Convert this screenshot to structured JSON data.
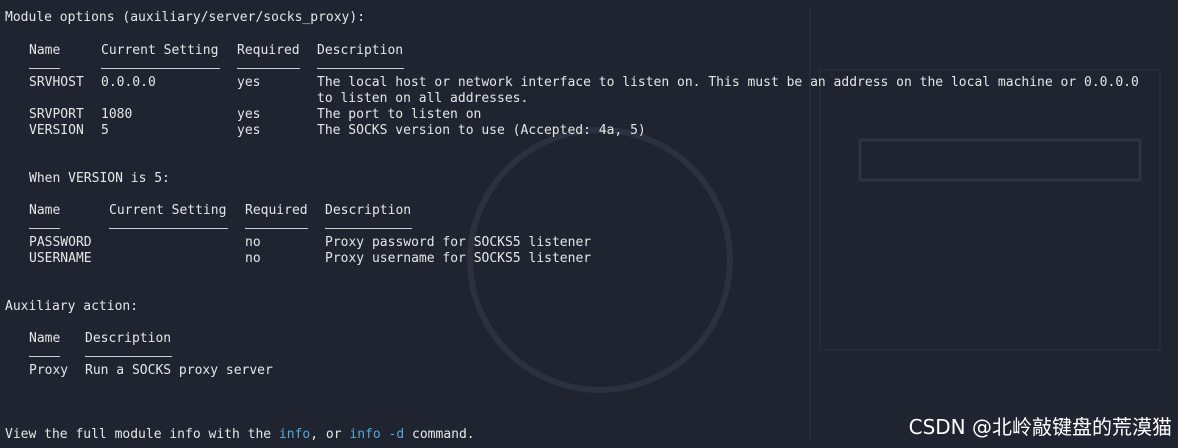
{
  "header": "Module options (auxiliary/server/socks_proxy):",
  "options": {
    "headers": [
      "Name",
      "Current Setting",
      "Required",
      "Description"
    ],
    "rows": [
      {
        "name": "SRVHOST",
        "setting": "0.0.0.0",
        "required": "yes",
        "description": "The local host or network interface to listen on. This must be an address on the local machine or 0.0.0.0",
        "description_cont": "to listen on all addresses."
      },
      {
        "name": "SRVPORT",
        "setting": "1080",
        "required": "yes",
        "description": "The port to listen on"
      },
      {
        "name": "VERSION",
        "setting": "5",
        "required": "yes",
        "description": "The SOCKS version to use (Accepted: 4a, 5)"
      }
    ]
  },
  "when_version": "When VERSION is 5:",
  "options5": {
    "headers": [
      "Name",
      "Current Setting",
      "Required",
      "Description"
    ],
    "rows": [
      {
        "name": "PASSWORD",
        "setting": "",
        "required": "no",
        "description": "Proxy password for SOCKS5 listener"
      },
      {
        "name": "USERNAME",
        "setting": "",
        "required": "no",
        "description": "Proxy username for SOCKS5 listener"
      }
    ]
  },
  "action_header": "Auxiliary action:",
  "actions": {
    "headers": [
      "Name",
      "Description"
    ],
    "rows": [
      {
        "name": "Proxy",
        "description": "Run a SOCKS proxy server"
      }
    ]
  },
  "footer": {
    "prefix": "View the full module info with the ",
    "cmd1": "info",
    "middle": ", or ",
    "cmd2": "info -d",
    "suffix": " command."
  },
  "watermark": "CSDN @北岭敲键盘的荒漠猫",
  "colors": {
    "background": "#1f2430",
    "text": "#e6e6e6",
    "command": "#58a6d6"
  }
}
